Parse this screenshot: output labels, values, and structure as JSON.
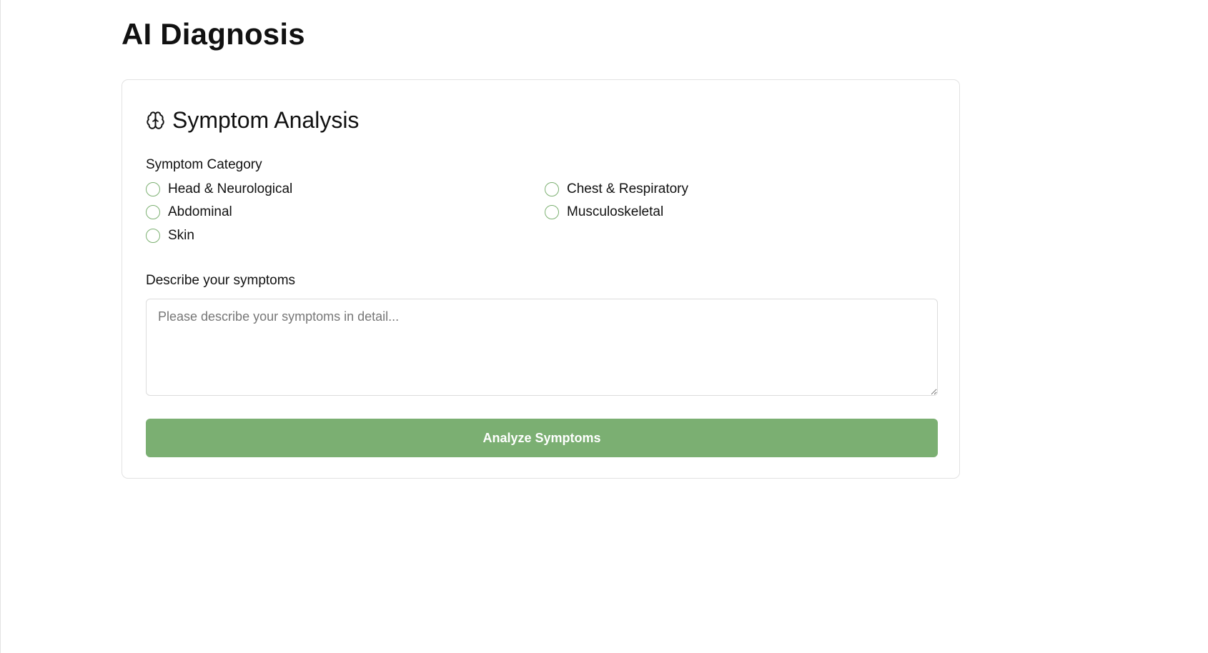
{
  "page": {
    "title": "AI Diagnosis"
  },
  "card": {
    "title": "Symptom Analysis",
    "icon": "brain-icon"
  },
  "category": {
    "label": "Symptom Category",
    "options": [
      {
        "label": "Head & Neurological",
        "selected": false
      },
      {
        "label": "Chest & Respiratory",
        "selected": false
      },
      {
        "label": "Abdominal",
        "selected": false
      },
      {
        "label": "Musculoskeletal",
        "selected": false
      },
      {
        "label": "Skin",
        "selected": false
      }
    ]
  },
  "symptoms": {
    "label": "Describe your symptoms",
    "placeholder": "Please describe your symptoms in detail...",
    "value": ""
  },
  "actions": {
    "analyze_label": "Analyze Symptoms"
  },
  "colors": {
    "accent": "#7baf72",
    "radio_border": "#7cb071"
  }
}
